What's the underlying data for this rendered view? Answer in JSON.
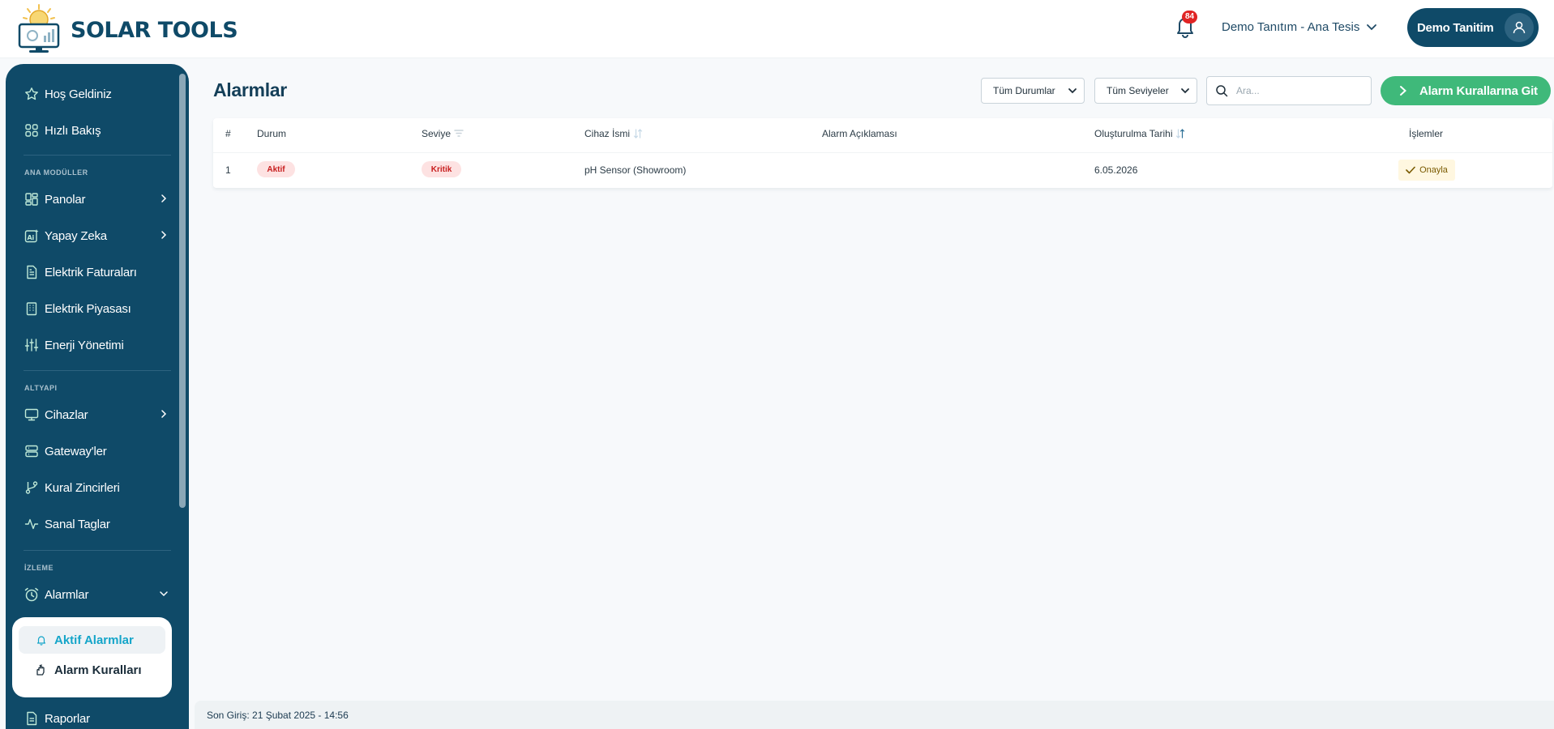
{
  "brand": {
    "name": "SOLAR TOOLS"
  },
  "header": {
    "notification_count": "84",
    "facility": "Demo Tanıtım - Ana Tesis",
    "user": "Demo Tanitim"
  },
  "sidebar": {
    "top_items": [
      {
        "label": "Hoş Geldiniz"
      },
      {
        "label": "Hızlı Bakış"
      }
    ],
    "sections": [
      {
        "label": "ANA MODÜLLER"
      },
      {
        "label": "ALTYAPI"
      },
      {
        "label": "İZLEME"
      }
    ],
    "ana_moduller": [
      {
        "label": "Panolar"
      },
      {
        "label": "Yapay Zeka"
      },
      {
        "label": "Elektrik Faturaları"
      },
      {
        "label": "Elektrik Piyasası"
      },
      {
        "label": "Enerji Yönetimi"
      }
    ],
    "altyapi": [
      {
        "label": "Cihazlar"
      },
      {
        "label": "Gateway'ler"
      },
      {
        "label": "Kural Zincirleri"
      },
      {
        "label": "Sanal Taglar"
      }
    ],
    "izleme": [
      {
        "label": "Alarmlar"
      }
    ],
    "alarm_sub": [
      {
        "label": "Aktif Alarmlar"
      },
      {
        "label": "Alarm Kuralları"
      }
    ],
    "bottom_items": [
      {
        "label": "Raporlar"
      }
    ]
  },
  "main": {
    "title": "Alarmlar",
    "filters": {
      "status_selected": "Tüm Durumlar",
      "level_selected": "Tüm Seviyeler"
    },
    "search": {
      "placeholder": "Ara..."
    },
    "primary_button": "Alarm Kurallarına Git",
    "table": {
      "headers": [
        "#",
        "Durum",
        "Seviye",
        "Cihaz İsmi",
        "Alarm Açıklaması",
        "Oluşturulma Tarihi",
        "İşlemler"
      ],
      "rows": [
        {
          "index": "1",
          "status": "Aktif",
          "level": "Kritik",
          "device": "pH Sensor (Showroom)",
          "description": "",
          "created": "6.05.2026",
          "action": "Onayla"
        }
      ]
    }
  },
  "footer": {
    "last_login": "Son Giriş: 21 Şubat 2025 - 14:56"
  },
  "colors": {
    "sidebar_bg": "#0f4a68",
    "primary_green": "#3fb97a",
    "active_cyan": "#14a5c9",
    "danger_badge_bg": "#fde2e2",
    "danger_badge_text": "#c81e1e"
  }
}
